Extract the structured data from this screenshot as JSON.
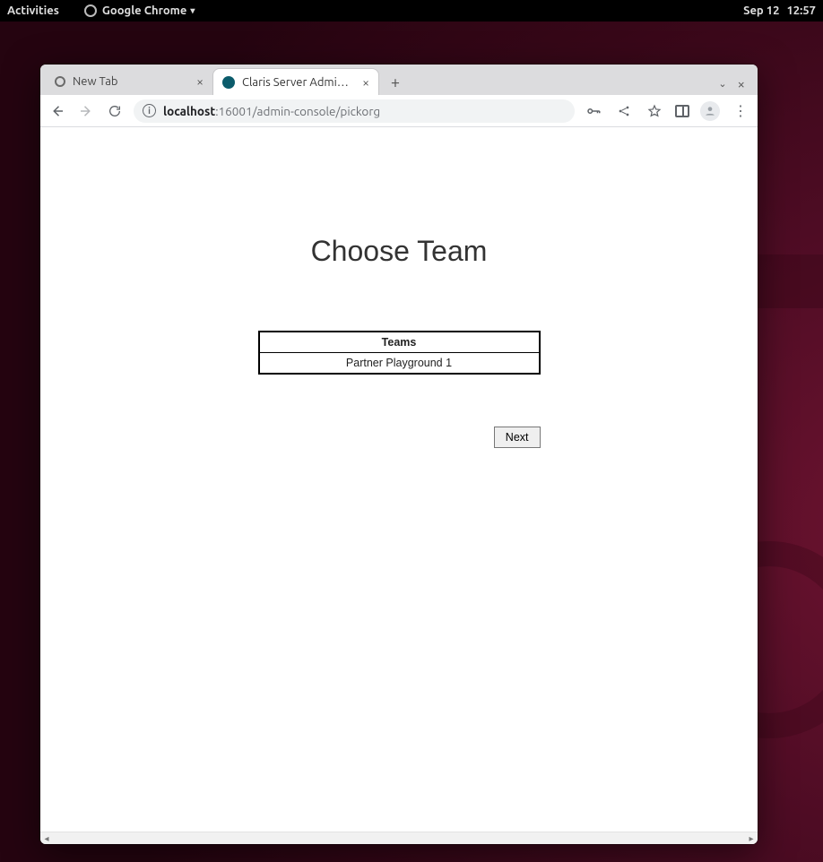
{
  "gnome": {
    "activities": "Activities",
    "app_name": "Google Chrome",
    "date": "Sep 12",
    "time": "12:57"
  },
  "chrome": {
    "tabs": [
      {
        "title": "New Tab",
        "active": false
      },
      {
        "title": "Claris Server Admin Co",
        "active": true
      }
    ],
    "omnibox": {
      "host": "localhost",
      "port_path": ":16001/admin-console/pickorg"
    }
  },
  "page": {
    "heading": "Choose Team",
    "table_header": "Teams",
    "rows": [
      "Partner Playground 1"
    ],
    "next_label": "Next"
  }
}
